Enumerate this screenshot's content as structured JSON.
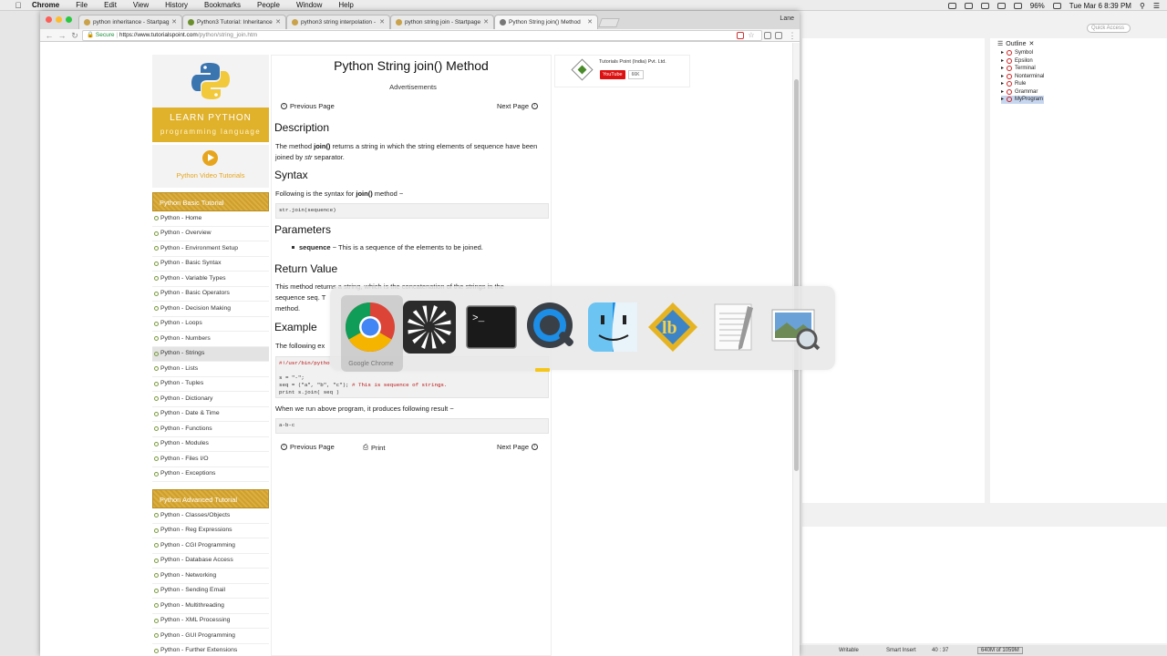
{
  "menubar": {
    "app_name": "Chrome",
    "items": [
      "File",
      "Edit",
      "View",
      "History",
      "Bookmarks",
      "People",
      "Window",
      "Help"
    ],
    "battery": "96%",
    "clock": "Tue Mar 6  8:39 PM"
  },
  "browser": {
    "tabs": [
      {
        "label": "python inheritance - Startpag"
      },
      {
        "label": "Python3 Tutorial: Inheritance"
      },
      {
        "label": "python3 string interpolation -"
      },
      {
        "label": "python string join - Startpage"
      },
      {
        "label": "Python String join() Method"
      }
    ],
    "profile": "Lane",
    "address": {
      "secure_label": "Secure",
      "url_host": "https://www.tutorialspoint.com",
      "url_path": "/python/string_join.htm"
    }
  },
  "sidebar": {
    "logo": {
      "title": "LEARN PYTHON",
      "subtitle": "programming language"
    },
    "video_label": "Python Video Tutorials",
    "basic_header": "Python Basic Tutorial",
    "basic_items": [
      "Python - Home",
      "Python - Overview",
      "Python - Environment Setup",
      "Python - Basic Syntax",
      "Python - Variable Types",
      "Python - Basic Operators",
      "Python - Decision Making",
      "Python - Loops",
      "Python - Numbers",
      "Python - Strings",
      "Python - Lists",
      "Python - Tuples",
      "Python - Dictionary",
      "Python - Date & Time",
      "Python - Functions",
      "Python - Modules",
      "Python - Files I/O",
      "Python - Exceptions"
    ],
    "advanced_header": "Python Advanced Tutorial",
    "advanced_items": [
      "Python - Classes/Objects",
      "Python - Reg Expressions",
      "Python - CGI Programming",
      "Python - Database Access",
      "Python - Networking",
      "Python - Sending Email",
      "Python - Multithreading",
      "Python - XML Processing",
      "Python - GUI Programming",
      "Python - Further Extensions"
    ]
  },
  "article": {
    "title": "Python String join() Method",
    "ads": "Advertisements",
    "prev": "Previous Page",
    "next": "Next Page",
    "print": "Print",
    "description_h": "Description",
    "description_pre": "The method ",
    "description_code": "join()",
    "description_mid": " returns a string in which the string elements of sequence have been joined by ",
    "description_str": "str",
    "description_post": " separator.",
    "syntax_h": "Syntax",
    "syntax_pre": "Following is the syntax for ",
    "syntax_code": "join()",
    "syntax_post": " method −",
    "syntax_box": "str.join(sequence)",
    "params_h": "Parameters",
    "param_name": "sequence",
    "param_desc": " − This is a sequence of the elements to be joined.",
    "return_h": "Return Value",
    "return_line1": "This method returns a string, which is the concatenation of the strings in the",
    "return_line2": "sequence seq. T",
    "return_line3": "method.",
    "example_h": "Example",
    "example_text": "The following ex",
    "code_line1": "#!/usr/bin/pytho",
    "code_line2": "s = \"-\";",
    "code_line3_a": "seq = (\"a\", \"b\", \"c\"); ",
    "code_line3_b": "# This is sequence of strings.",
    "code_line4": "print s.join( seq )",
    "result_text": "When we run above program, it produces following result −",
    "result_box": "a-b-c"
  },
  "ad": {
    "company": "Tutorials Point (India) Pvt. Ltd.",
    "youtube": "YouTube",
    "subscribers": "66K"
  },
  "switcher": {
    "selected_label": "Google Chrome",
    "apps": [
      "google-chrome-icon",
      "fan-app-icon",
      "terminal-icon",
      "quicktime-icon",
      "finder-icon",
      "bbedit-icon",
      "textedit-icon",
      "preview-icon"
    ]
  },
  "ide": {
    "quick_access": "Quick Access",
    "outline_tab": "Outline",
    "outline_items": [
      "Symbol",
      "Epsilon",
      "Terminal",
      "Nonterminal",
      "Rule",
      "Grammar",
      "MyProgram"
    ],
    "status_writable": "Writable",
    "status_insert": "Smart Insert",
    "status_pos": "40 : 37",
    "status_mem": "640M of 1059M"
  }
}
